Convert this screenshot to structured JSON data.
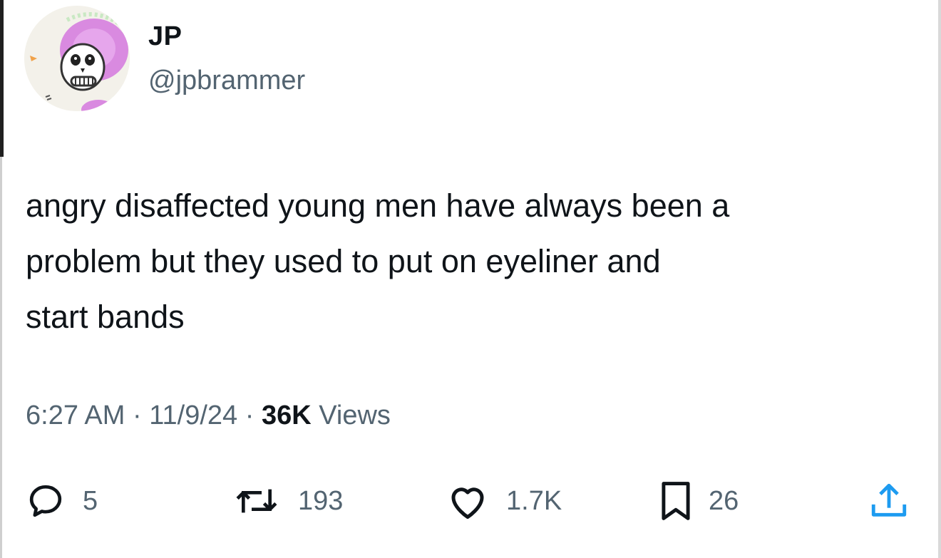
{
  "tweet": {
    "author": {
      "name": "JP",
      "handle": "@jpbrammer",
      "avatar_icon": "skeleton-sombrero-avatar"
    },
    "text": "angry disaffected young men have always been a\nproblem but they used to put on eyeliner and\nstart bands",
    "meta": {
      "time": "6:27 AM",
      "separator": "·",
      "date": "11/9/24",
      "views_count": "36K",
      "views_label": "Views"
    },
    "actions": {
      "replies": "5",
      "reposts": "193",
      "likes": "1.7K",
      "bookmarks": "26"
    }
  },
  "colors": {
    "text_primary": "#0f1419",
    "text_secondary": "#536471",
    "avatar_hat": "#d98ae0"
  }
}
